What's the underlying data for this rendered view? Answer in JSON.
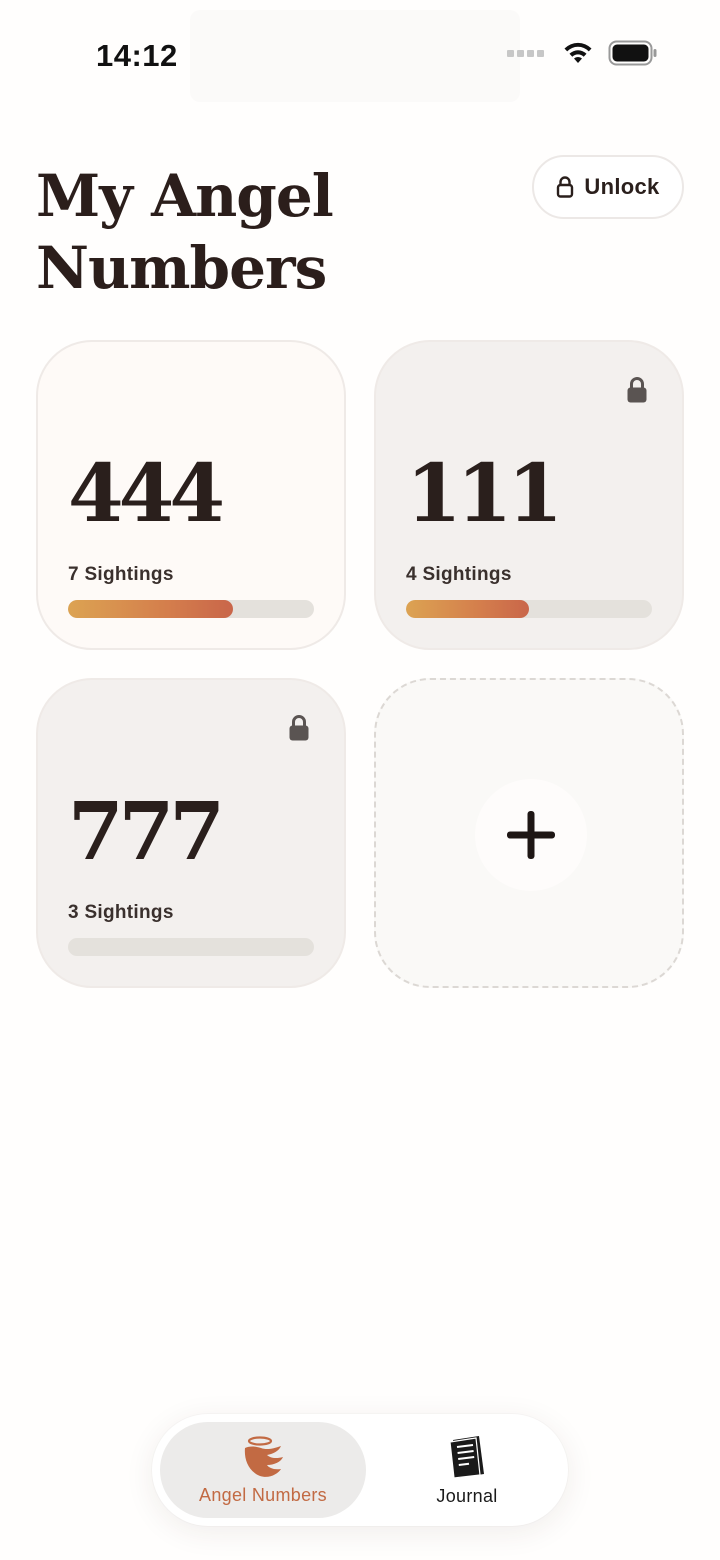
{
  "status_bar": {
    "time": "14:12"
  },
  "header": {
    "title_line1": "My Angel",
    "title_line2": "Numbers",
    "unlock_label": "Unlock"
  },
  "cards": [
    {
      "number": "444",
      "sightings": "7 Sightings",
      "progress": 0.67,
      "locked": false
    },
    {
      "number": "111",
      "sightings": "4 Sightings",
      "progress": 0.5,
      "locked": true
    },
    {
      "number": "777",
      "sightings": "3 Sightings",
      "progress": 0.0,
      "locked": true
    }
  ],
  "add_card": {
    "icon": "plus-icon"
  },
  "tab_bar": {
    "tabs": [
      {
        "label": "Angel Numbers",
        "icon": "angel-wing-icon",
        "selected": true
      },
      {
        "label": "Journal",
        "icon": "journal-icon",
        "selected": false
      }
    ]
  },
  "colors": {
    "accent": "#c26a43",
    "progress_start": "#dca352",
    "progress_end": "#c9664a",
    "text": "#2a1f1c"
  }
}
